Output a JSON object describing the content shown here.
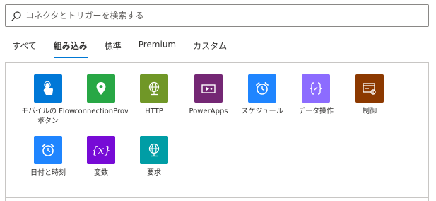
{
  "search": {
    "placeholder": "コネクタとトリガーを検索する"
  },
  "tabs": [
    {
      "label": "すべて"
    },
    {
      "label": "組み込み"
    },
    {
      "label": "標準"
    },
    {
      "label": "Premium"
    },
    {
      "label": "カスタム"
    }
  ],
  "active_tab": "組み込み",
  "connectors": [
    {
      "label": "モバイルの Flow ボタン",
      "color": "#0078d7",
      "icon": "touch-hand-icon"
    },
    {
      "label": "connectionProv",
      "color": "#28a745",
      "icon": "location-pin-icon"
    },
    {
      "label": "HTTP",
      "color": "#709727",
      "icon": "globe-icon"
    },
    {
      "label": "PowerApps",
      "color": "#742774",
      "icon": "powerapps-icon"
    },
    {
      "label": "スケジュール",
      "color": "#1f85ff",
      "icon": "alarm-clock-icon"
    },
    {
      "label": "データ操作",
      "color": "#8c6cff",
      "icon": "data-operation-icon"
    },
    {
      "label": "制御",
      "color": "#8c3900",
      "icon": "control-gear-icon"
    },
    {
      "label": "日付と時刻",
      "color": "#1f85ff",
      "icon": "alarm-clock-icon"
    },
    {
      "label": "変数",
      "color": "#770bd6",
      "icon": "variable-x-icon"
    },
    {
      "label": "要求",
      "color": "#009da5",
      "icon": "request-globe-icon"
    }
  ]
}
